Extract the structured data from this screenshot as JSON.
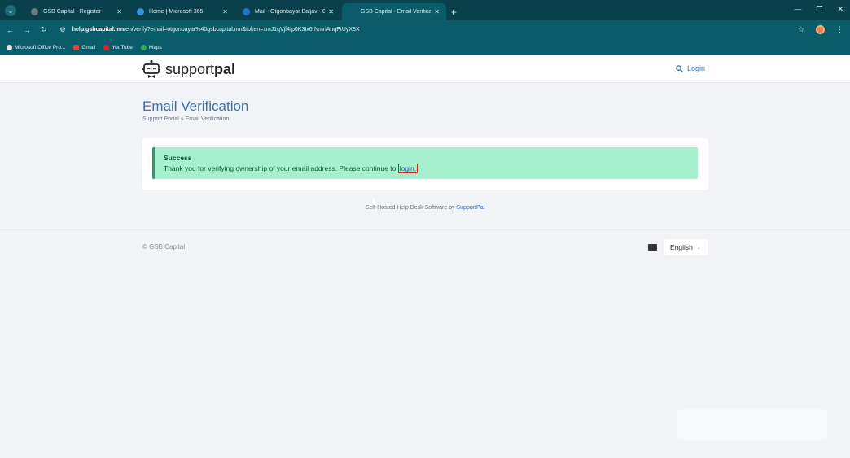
{
  "browser": {
    "tabs": [
      {
        "title": "GSB Capital - Register",
        "fav_color": "#6b7a80"
      },
      {
        "title": "Home | Microsoft 365",
        "fav_color": "#3a8fe0"
      },
      {
        "title": "Mail - Otgonbayar Baljav - Outl",
        "fav_color": "#1e74c8"
      },
      {
        "title": "GSB Capital - Email Verification",
        "fav_color": "#0b5c6b"
      }
    ],
    "url_domain": "help.gsbcapital.mn",
    "url_path": "/en/verify?email=otgonbayar%40gsbcapital.mn&token=xmJ1qVjf4Ip0K3Ix6rNmrlAnqPtUyX8X",
    "bookmarks": [
      {
        "label": "Microsoft Office Pro...",
        "color": "#e6e6e6"
      },
      {
        "label": "Gmail",
        "color": "#e04a3a"
      },
      {
        "label": "YouTube",
        "color": "#e02020"
      },
      {
        "label": "Maps",
        "color": "#34a853"
      }
    ]
  },
  "site": {
    "logo_light": "support",
    "logo_bold": "pal",
    "login": "Login"
  },
  "main": {
    "title": "Email Verification",
    "breadcrumb_home": "Support Portal",
    "breadcrumb_sep": "»",
    "breadcrumb_current": "Email Verification",
    "alert_heading": "Success",
    "alert_text": "Thank you for verifying ownership of your email address. Please continue to",
    "alert_link": "login.",
    "powered_text": "Self-Hosted Help Desk Software by",
    "powered_link": "SupportPal"
  },
  "footer": {
    "copyright": "© GSB Capital",
    "language": "English"
  },
  "colors": {
    "accent": "#3a6fb0",
    "success_bg": "#a6f0cf",
    "success_border": "#27996a",
    "browser": "#0b5c6b"
  }
}
